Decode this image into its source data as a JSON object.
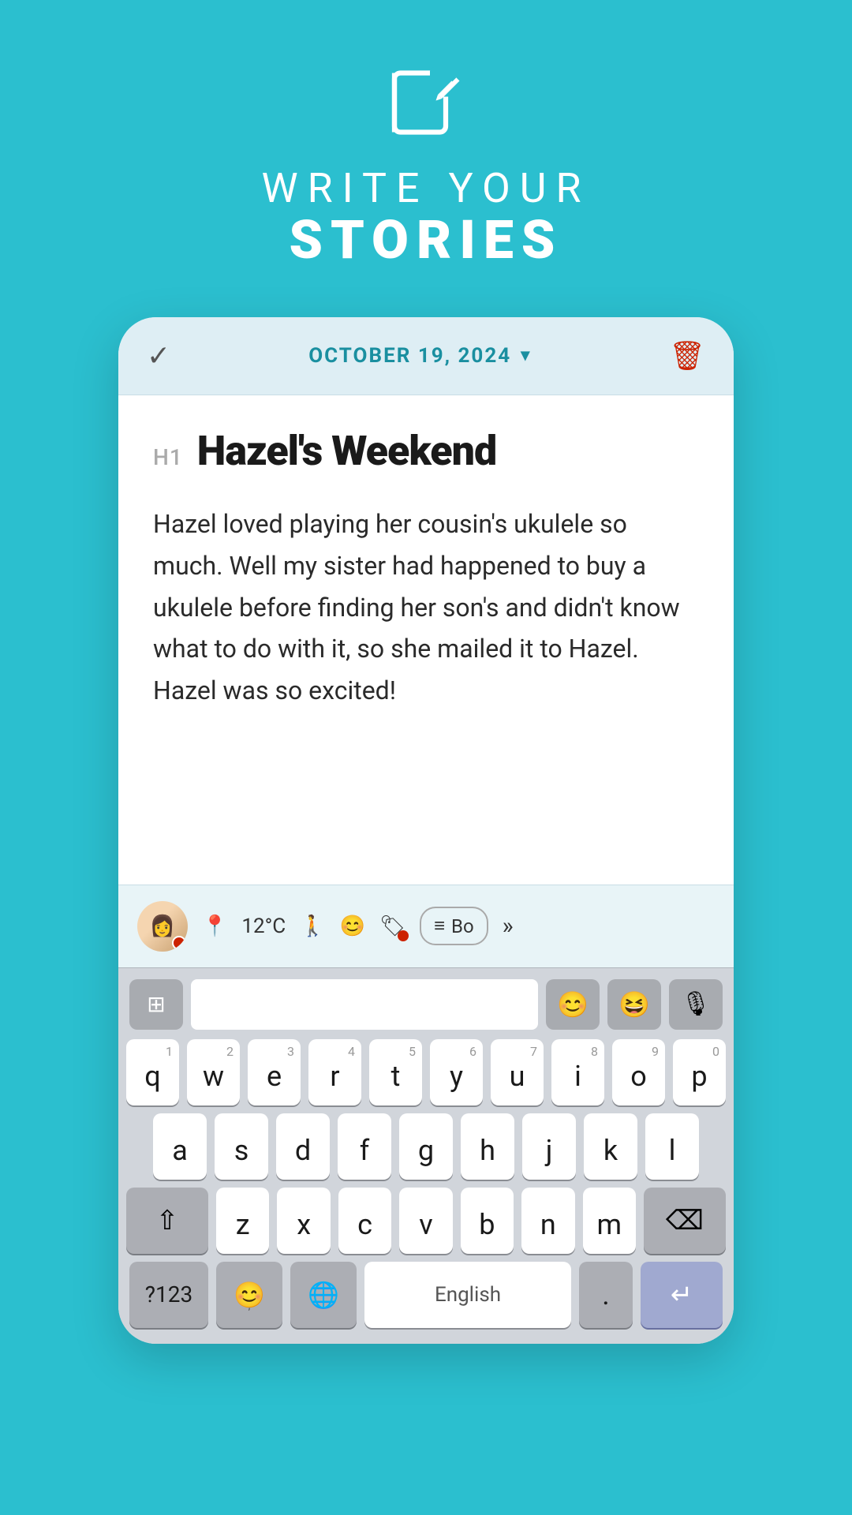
{
  "background_color": "#2bbfcf",
  "header": {
    "icon_label": "edit-icon",
    "write_label": "WRITE YOUR",
    "stories_label": "STORIES"
  },
  "toolbar": {
    "date_text": "OCTOBER 19, 2024",
    "check_label": "✓",
    "chevron_label": "▾",
    "delete_label": "🗑"
  },
  "story": {
    "h1_label": "H1",
    "title": "Hazel's Weekend",
    "body": "Hazel loved playing her cousin's ukulele so much. Well my sister had happened to buy a ukulele before finding her son's and didn't know what to do with it, so she mailed it to Hazel. Hazel was so excited!"
  },
  "format_toolbar": {
    "location_icon": "📍",
    "temperature": "12°C",
    "person_icon": "🚶",
    "emoji_icon": "😊",
    "tag_icon": "🏷",
    "book_lines": "≡",
    "book_label": "Bo",
    "more_label": "»"
  },
  "keyboard": {
    "rows": [
      [
        "q",
        "w",
        "e",
        "r",
        "t",
        "y",
        "u",
        "i",
        "o",
        "p"
      ],
      [
        "a",
        "s",
        "d",
        "f",
        "g",
        "h",
        "j",
        "k",
        "l"
      ],
      [
        "z",
        "x",
        "c",
        "v",
        "b",
        "n",
        "m"
      ]
    ],
    "numbers": [
      "1",
      "2",
      "3",
      "4",
      "5",
      "6",
      "7",
      "8",
      "9",
      "0"
    ],
    "num_btn_label": "?123",
    "emoji_face_label": "😊",
    "globe_label": "🌐",
    "space_label": "English",
    "period_label": ".",
    "return_label": "↵",
    "shift_label": "⇧",
    "del_label": "⌫",
    "grid_label": "⊞",
    "smile_emoji": "😊",
    "laugh_emoji": "😆",
    "mic_label": "🎙"
  }
}
